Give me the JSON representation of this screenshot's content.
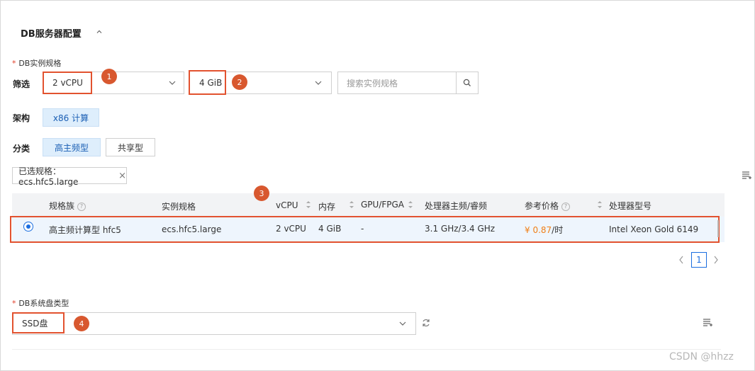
{
  "section": {
    "title": "DB服务器配置"
  },
  "instance_spec": {
    "required_mark": "*",
    "label": "DB实例规格",
    "filter_label": "筛选",
    "cpu_value": "2 vCPU",
    "mem_value": "4 GiB",
    "search_placeholder": "搜索实例规格"
  },
  "arch": {
    "label": "架构",
    "option": "x86 计算"
  },
  "category": {
    "label": "分类",
    "options": [
      "高主频型",
      "共享型"
    ]
  },
  "selected_tag": "已选规格：ecs.hfc5.large",
  "table": {
    "headers": [
      "规格族",
      "实例规格",
      "vCPU",
      "内存",
      "GPU/FPGA",
      "处理器主频/睿频",
      "参考价格",
      "处理器型号"
    ],
    "row": {
      "family": "高主频计算型 hfc5",
      "spec": "ecs.hfc5.large",
      "vcpu": "2 vCPU",
      "mem": "4 GiB",
      "gpu": "-",
      "freq": "3.1 GHz/3.4 GHz",
      "price_prefix": "¥ 0.87",
      "price_suffix": "/时",
      "cpu_model": "Intel Xeon Gold 6149"
    }
  },
  "pagination": {
    "current": "1"
  },
  "disk": {
    "required_mark": "*",
    "label": "DB系统盘类型",
    "value": "SSD盘"
  },
  "badges": [
    "1",
    "2",
    "3",
    "4"
  ],
  "watermark": "CSDN @hhzz",
  "colors": {
    "accent": "#1b6ee0",
    "highlight": "#e2522f",
    "price": "#f07f17"
  }
}
